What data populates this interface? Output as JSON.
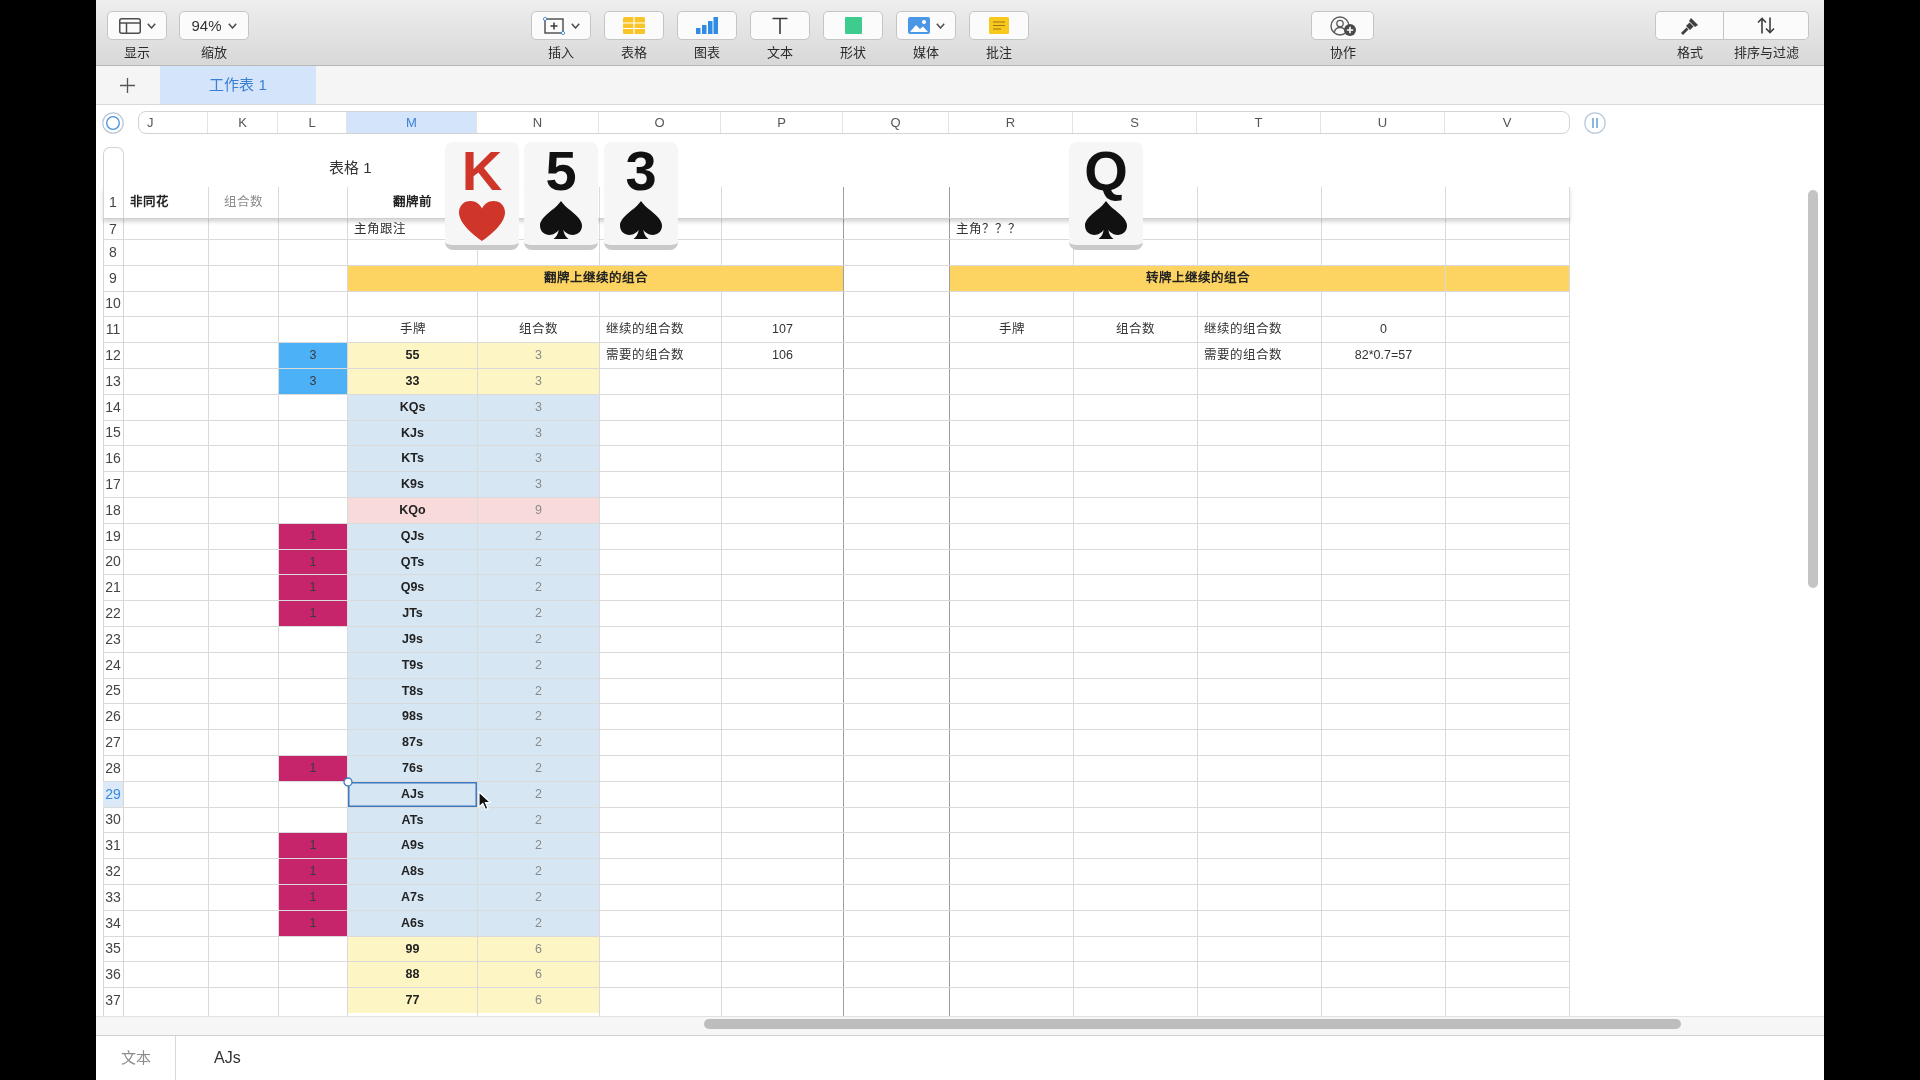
{
  "toolbar": {
    "left": [
      {
        "kind": "view",
        "label": "显示",
        "dropdown": true
      },
      {
        "kind": "zoom",
        "label": "缩放",
        "value": "94%",
        "dropdown": true
      }
    ],
    "insert": [
      {
        "kind": "insert",
        "label": "插入",
        "dropdown": true
      },
      {
        "kind": "table",
        "label": "表格",
        "dropdown": false
      },
      {
        "kind": "chart",
        "label": "图表",
        "dropdown": false
      },
      {
        "kind": "text",
        "label": "文本",
        "dropdown": false
      },
      {
        "kind": "shape",
        "label": "形状",
        "dropdown": false
      },
      {
        "kind": "media",
        "label": "媒体",
        "dropdown": true
      },
      {
        "kind": "comment",
        "label": "批注",
        "dropdown": false
      }
    ],
    "share": [
      {
        "kind": "collaborate",
        "label": "协作",
        "dropdown": false
      }
    ],
    "organize": [
      {
        "kind": "format",
        "label": "格式",
        "dropdown": false
      },
      {
        "kind": "sort",
        "label": "排序与过滤",
        "dropdown": false
      }
    ]
  },
  "sheet_tabs": [
    {
      "label": "工作表 1",
      "selected": true
    }
  ],
  "columns": [
    {
      "letter": "J",
      "selected": false
    },
    {
      "letter": "K",
      "selected": false
    },
    {
      "letter": "L",
      "selected": false
    },
    {
      "letter": "M",
      "selected": true
    },
    {
      "letter": "N",
      "selected": false
    },
    {
      "letter": "O",
      "selected": false
    },
    {
      "letter": "P",
      "selected": false
    },
    {
      "letter": "Q",
      "selected": false
    },
    {
      "letter": "R",
      "selected": false
    },
    {
      "letter": "S",
      "selected": false
    },
    {
      "letter": "T",
      "selected": false
    },
    {
      "letter": "U",
      "selected": false
    },
    {
      "letter": "V",
      "selected": false
    }
  ],
  "table": {
    "title": "表格 1",
    "rows": [
      {
        "number": "1",
        "kind": "header",
        "selected": false,
        "cells": [
          {
            "text": "非同花",
            "kind": "heading"
          },
          {
            "text": "组合数",
            "kind": "count"
          },
          null,
          {
            "text": "翻牌前",
            "kind": "hand"
          }
        ]
      },
      {
        "number": "7",
        "kind": "body",
        "selected": false,
        "cells": [
          null,
          null,
          null,
          {
            "text": "主角跟注",
            "kind": "label"
          },
          null,
          null,
          null,
          null,
          {
            "text": "主角？？？",
            "kind": "label"
          }
        ]
      },
      {
        "number": "8",
        "kind": "body",
        "selected": false
      },
      {
        "number": "9",
        "kind": "body",
        "selected": false,
        "cells": [
          null,
          null,
          null,
          {
            "text": "翻牌上继续的组合",
            "kind": "banner",
            "color": "#fdd462"
          },
          {
            "kind": "join"
          },
          {
            "kind": "join"
          },
          {
            "kind": "join"
          },
          null,
          {
            "text": "转牌上继续的组合",
            "kind": "banner",
            "color": "#fdd462"
          },
          {
            "kind": "join"
          },
          {
            "kind": "join"
          },
          {
            "kind": "join"
          },
          {
            "kind": "fill",
            "color": "#fdd462"
          }
        ]
      },
      {
        "number": "10",
        "kind": "body",
        "selected": false
      },
      {
        "number": "11",
        "kind": "body",
        "selected": false,
        "cells": [
          null,
          null,
          null,
          {
            "text": "手牌",
            "kind": "value"
          },
          {
            "text": "组合数",
            "kind": "value"
          },
          {
            "text": "继续的组合数",
            "kind": "label"
          },
          {
            "text": "107",
            "kind": "value"
          },
          null,
          {
            "text": "手牌",
            "kind": "value"
          },
          {
            "text": "组合数",
            "kind": "value"
          },
          {
            "text": "继续的组合数",
            "kind": "label"
          },
          {
            "text": "0",
            "kind": "value"
          }
        ]
      },
      {
        "number": "12",
        "kind": "body",
        "selected": false,
        "cells": [
          null,
          null,
          {
            "text": "3",
            "kind": "marker",
            "color": "#4cb1f7"
          },
          {
            "text": "55",
            "kind": "hand",
            "color": "#fdf6c4"
          },
          {
            "text": "3",
            "kind": "count",
            "color": "#fdf6c4"
          },
          {
            "text": "需要的组合数",
            "kind": "label"
          },
          {
            "text": "106",
            "kind": "value"
          },
          null,
          null,
          null,
          {
            "text": "需要的组合数",
            "kind": "label"
          },
          {
            "text": "82*0.7=57",
            "kind": "value"
          }
        ]
      },
      {
        "number": "13",
        "kind": "body",
        "selected": false,
        "cells": [
          null,
          null,
          {
            "text": "3",
            "kind": "marker",
            "color": "#4cb1f7"
          },
          {
            "text": "33",
            "kind": "hand",
            "color": "#fdf6c4"
          },
          {
            "text": "3",
            "kind": "count",
            "color": "#fdf6c4"
          }
        ]
      },
      {
        "number": "14",
        "kind": "body",
        "selected": false,
        "cells": [
          null,
          null,
          null,
          {
            "text": "KQs",
            "kind": "hand",
            "color": "#d6e6f3"
          },
          {
            "text": "3",
            "kind": "count",
            "color": "#d6e6f3"
          }
        ]
      },
      {
        "number": "15",
        "kind": "body",
        "selected": false,
        "cells": [
          null,
          null,
          null,
          {
            "text": "KJs",
            "kind": "hand",
            "color": "#d6e6f3"
          },
          {
            "text": "3",
            "kind": "count",
            "color": "#d6e6f3"
          }
        ]
      },
      {
        "number": "16",
        "kind": "body",
        "selected": false,
        "cells": [
          null,
          null,
          null,
          {
            "text": "KTs",
            "kind": "hand",
            "color": "#d6e6f3"
          },
          {
            "text": "3",
            "kind": "count",
            "color": "#d6e6f3"
          }
        ]
      },
      {
        "number": "17",
        "kind": "body",
        "selected": false,
        "cells": [
          null,
          null,
          null,
          {
            "text": "K9s",
            "kind": "hand",
            "color": "#d6e6f3"
          },
          {
            "text": "3",
            "kind": "count",
            "color": "#d6e6f3"
          }
        ]
      },
      {
        "number": "18",
        "kind": "body",
        "selected": false,
        "cells": [
          null,
          null,
          null,
          {
            "text": "KQo",
            "kind": "hand",
            "color": "#f9dadb"
          },
          {
            "text": "9",
            "kind": "count",
            "color": "#f9dadb"
          }
        ]
      },
      {
        "number": "19",
        "kind": "body",
        "selected": false,
        "cells": [
          null,
          null,
          {
            "text": "1",
            "kind": "marker",
            "color": "#c6246b"
          },
          {
            "text": "QJs",
            "kind": "hand",
            "color": "#d6e6f3"
          },
          {
            "text": "2",
            "kind": "count",
            "color": "#d6e6f3"
          }
        ]
      },
      {
        "number": "20",
        "kind": "body",
        "selected": false,
        "cells": [
          null,
          null,
          {
            "text": "1",
            "kind": "marker",
            "color": "#c6246b"
          },
          {
            "text": "QTs",
            "kind": "hand",
            "color": "#d6e6f3"
          },
          {
            "text": "2",
            "kind": "count",
            "color": "#d6e6f3"
          }
        ]
      },
      {
        "number": "21",
        "kind": "body",
        "selected": false,
        "cells": [
          null,
          null,
          {
            "text": "1",
            "kind": "marker",
            "color": "#c6246b"
          },
          {
            "text": "Q9s",
            "kind": "hand",
            "color": "#d6e6f3"
          },
          {
            "text": "2",
            "kind": "count",
            "color": "#d6e6f3"
          }
        ]
      },
      {
        "number": "22",
        "kind": "body",
        "selected": false,
        "cells": [
          null,
          null,
          {
            "text": "1",
            "kind": "marker",
            "color": "#c6246b"
          },
          {
            "text": "JTs",
            "kind": "hand",
            "color": "#d6e6f3"
          },
          {
            "text": "2",
            "kind": "count",
            "color": "#d6e6f3"
          }
        ]
      },
      {
        "number": "23",
        "kind": "body",
        "selected": false,
        "cells": [
          null,
          null,
          null,
          {
            "text": "J9s",
            "kind": "hand",
            "color": "#d6e6f3"
          },
          {
            "text": "2",
            "kind": "count",
            "color": "#d6e6f3"
          }
        ]
      },
      {
        "number": "24",
        "kind": "body",
        "selected": false,
        "cells": [
          null,
          null,
          null,
          {
            "text": "T9s",
            "kind": "hand",
            "color": "#d6e6f3"
          },
          {
            "text": "2",
            "kind": "count",
            "color": "#d6e6f3"
          }
        ]
      },
      {
        "number": "25",
        "kind": "body",
        "selected": false,
        "cells": [
          null,
          null,
          null,
          {
            "text": "T8s",
            "kind": "hand",
            "color": "#d6e6f3"
          },
          {
            "text": "2",
            "kind": "count",
            "color": "#d6e6f3"
          }
        ]
      },
      {
        "number": "26",
        "kind": "body",
        "selected": false,
        "cells": [
          null,
          null,
          null,
          {
            "text": "98s",
            "kind": "hand",
            "color": "#d6e6f3"
          },
          {
            "text": "2",
            "kind": "count",
            "color": "#d6e6f3"
          }
        ]
      },
      {
        "number": "27",
        "kind": "body",
        "selected": false,
        "cells": [
          null,
          null,
          null,
          {
            "text": "87s",
            "kind": "hand",
            "color": "#d6e6f3"
          },
          {
            "text": "2",
            "kind": "count",
            "color": "#d6e6f3"
          }
        ]
      },
      {
        "number": "28",
        "kind": "body",
        "selected": false,
        "cells": [
          null,
          null,
          {
            "text": "1",
            "kind": "marker",
            "color": "#c6246b"
          },
          {
            "text": "76s",
            "kind": "hand",
            "color": "#d6e6f3"
          },
          {
            "text": "2",
            "kind": "count",
            "color": "#d6e6f3"
          }
        ]
      },
      {
        "number": "29",
        "kind": "body",
        "selected": true,
        "cells": [
          null,
          null,
          null,
          {
            "text": "AJs",
            "kind": "hand",
            "color": "#d6e6f3"
          },
          {
            "text": "2",
            "kind": "count",
            "color": "#d6e6f3"
          }
        ]
      },
      {
        "number": "30",
        "kind": "body",
        "selected": false,
        "cells": [
          null,
          null,
          null,
          {
            "text": "ATs",
            "kind": "hand",
            "color": "#d6e6f3"
          },
          {
            "text": "2",
            "kind": "count",
            "color": "#d6e6f3"
          }
        ]
      },
      {
        "number": "31",
        "kind": "body",
        "selected": false,
        "cells": [
          null,
          null,
          {
            "text": "1",
            "kind": "marker",
            "color": "#c6246b"
          },
          {
            "text": "A9s",
            "kind": "hand",
            "color": "#d6e6f3"
          },
          {
            "text": "2",
            "kind": "count",
            "color": "#d6e6f3"
          }
        ]
      },
      {
        "number": "32",
        "kind": "body",
        "selected": false,
        "cells": [
          null,
          null,
          {
            "text": "1",
            "kind": "marker",
            "color": "#c6246b"
          },
          {
            "text": "A8s",
            "kind": "hand",
            "color": "#d6e6f3"
          },
          {
            "text": "2",
            "kind": "count",
            "color": "#d6e6f3"
          }
        ]
      },
      {
        "number": "33",
        "kind": "body",
        "selected": false,
        "cells": [
          null,
          null,
          {
            "text": "1",
            "kind": "marker",
            "color": "#c6246b"
          },
          {
            "text": "A7s",
            "kind": "hand",
            "color": "#d6e6f3"
          },
          {
            "text": "2",
            "kind": "count",
            "color": "#d6e6f3"
          }
        ]
      },
      {
        "number": "34",
        "kind": "body",
        "selected": false,
        "cells": [
          null,
          null,
          {
            "text": "1",
            "kind": "marker",
            "color": "#c6246b"
          },
          {
            "text": "A6s",
            "kind": "hand",
            "color": "#d6e6f3"
          },
          {
            "text": "2",
            "kind": "count",
            "color": "#d6e6f3"
          }
        ]
      },
      {
        "number": "35",
        "kind": "body",
        "selected": false,
        "cells": [
          null,
          null,
          null,
          {
            "text": "99",
            "kind": "hand",
            "color": "#fdf6c4"
          },
          {
            "text": "6",
            "kind": "count",
            "color": "#fdf6c4"
          }
        ]
      },
      {
        "number": "36",
        "kind": "body",
        "selected": false,
        "cells": [
          null,
          null,
          null,
          {
            "text": "88",
            "kind": "hand",
            "color": "#fdf6c4"
          },
          {
            "text": "6",
            "kind": "count",
            "color": "#fdf6c4"
          }
        ]
      },
      {
        "number": "37",
        "kind": "body",
        "selected": false,
        "cells": [
          null,
          null,
          null,
          {
            "text": "77",
            "kind": "hand",
            "color": "#fdf6c4"
          },
          {
            "text": "6",
            "kind": "count",
            "color": "#fdf6c4"
          }
        ]
      }
    ]
  },
  "cards": [
    {
      "rank": "K",
      "kind": "heart"
    },
    {
      "rank": "5",
      "kind": "spade"
    },
    {
      "rank": "3",
      "kind": "spade"
    },
    {
      "rank": "Q",
      "kind": "spade"
    }
  ],
  "formula_bar": {
    "label": "文本",
    "value": "AJs"
  }
}
